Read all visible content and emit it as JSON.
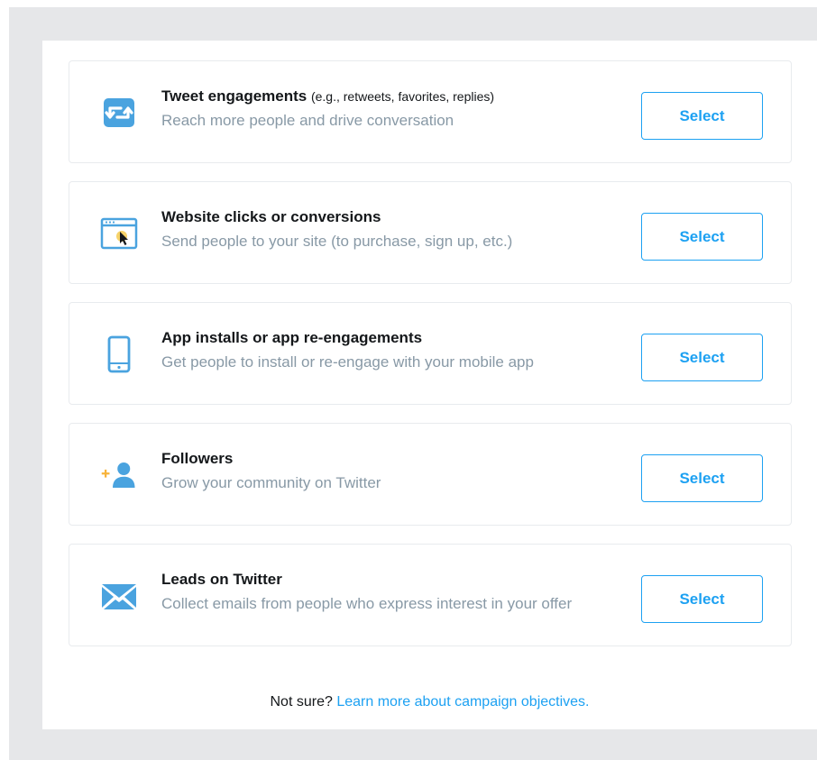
{
  "objectives": [
    {
      "icon": "retweet-icon",
      "title": "Tweet engagements",
      "hint": "(e.g., retweets, favorites, replies)",
      "description": "Reach more people and drive conversation",
      "button_label": "Select"
    },
    {
      "icon": "website-click-icon",
      "title": "Website clicks or conversions",
      "hint": "",
      "description": "Send people to your site (to purchase, sign up, etc.)",
      "button_label": "Select"
    },
    {
      "icon": "mobile-phone-icon",
      "title": "App installs or app re-engagements",
      "hint": "",
      "description": "Get people to install or re-engage with your mobile app",
      "button_label": "Select"
    },
    {
      "icon": "add-follower-icon",
      "title": "Followers",
      "hint": "",
      "description": "Grow your community on Twitter",
      "button_label": "Select"
    },
    {
      "icon": "envelope-icon",
      "title": "Leads on Twitter",
      "hint": "",
      "description": "Collect emails from people who express interest in your offer",
      "button_label": "Select"
    }
  ],
  "footer": {
    "prefix": "Not sure?",
    "link_text": "Learn more about campaign objectives."
  },
  "colors": {
    "accent": "#1da1f2",
    "icon": "#4aa3df",
    "follower_plus": "#f7b33a",
    "muted_text": "#8899a6"
  }
}
